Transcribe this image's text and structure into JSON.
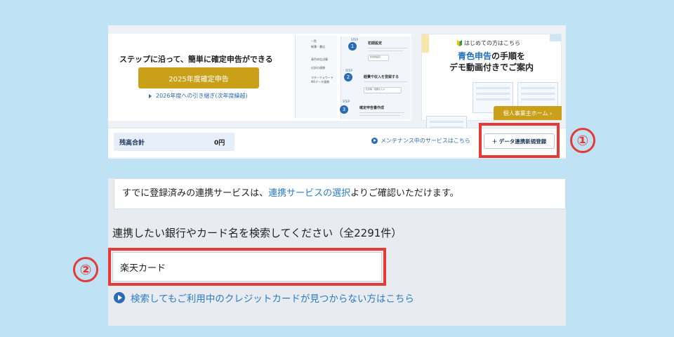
{
  "top": {
    "hero_text": "ステップに沿って、簡単に確定申告ができる",
    "main_button": "2025年度確定申告",
    "prev_link": "2026年度への引き継ぎ(次年度繰越)",
    "mock_menu": [
      "一覧",
      "帳簿・書出",
      "青色申告決算",
      "仕訳の連携",
      "マネーフォワード",
      "MEデータ連携"
    ],
    "steps": [
      {
        "tag": "STEP",
        "num": "1",
        "title": "初期設定",
        "pill": "利用者設定"
      },
      {
        "tag": "STEP",
        "num": "2",
        "title": "経費や収入を登録する",
        "pill": "仕訳帳・経費を入力"
      },
      {
        "tag": "STEP",
        "num": "3",
        "title": "確定申告書作成",
        "pill": ""
      }
    ],
    "beginner_head": "はじめての方はこちら",
    "beginner_title_1a": "青色申告",
    "beginner_title_1b": "の手順を",
    "beginner_title_2": "デモ動画付きでご案内",
    "home_button": "個人事業主ホーム ›",
    "balance_label": "残高合計",
    "balance_value": "0円",
    "maintenance_link": "メンテナンス中のサービスはこちら",
    "data_button": "＋ データ連携新規登録",
    "marker_1": "①"
  },
  "bottom": {
    "info_pre": "すでに登録済みの連携サービスは、",
    "info_link": "連携サービスの選択",
    "info_post": "よりご確認いただけます。",
    "search_heading": "連携したい銀行やカード名を検索してください（全2291件）",
    "search_value": "楽天カード",
    "notfound_link": "検索してもご利用中のクレジットカードが見つからない方はこちら",
    "marker_2": "②"
  },
  "colors": {
    "accent_gold": "#c9a018",
    "link_blue": "#2a7cc2",
    "highlight_red": "#e53b36",
    "background": "#bfe3f5"
  },
  "icons": [
    "play-circle-icon",
    "plus-icon",
    "caret-right-icon",
    "beginner-mark-icon"
  ]
}
